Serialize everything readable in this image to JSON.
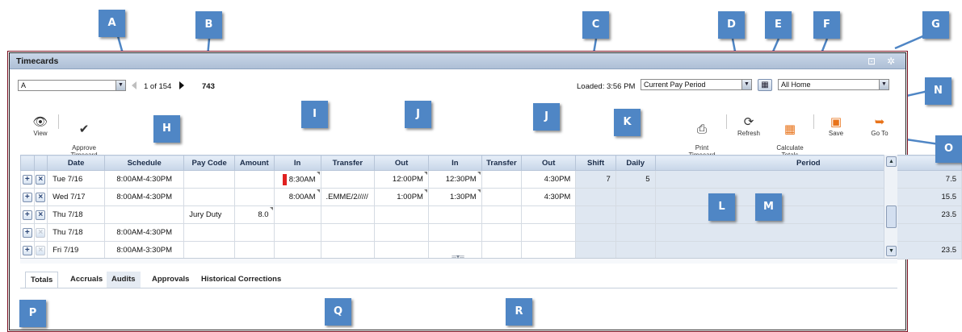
{
  "window": {
    "title": "Timecards"
  },
  "header": {
    "employee_select": "A",
    "pager_text": "1 of 154",
    "employee_id": "743",
    "loaded_text": "Loaded: 3:56 PM",
    "period_select": "Current Pay Period",
    "location_select": "All Home"
  },
  "toolbar": {
    "view": "View",
    "approve": "Approve\nTimecard",
    "print": "Print\nTimecard",
    "refresh": "Refresh",
    "calc": "Calculate\nTotals",
    "save": "Save",
    "goto": "Go To"
  },
  "grid": {
    "columns": [
      "Date",
      "Schedule",
      "Pay Code",
      "Amount",
      "In",
      "Transfer",
      "Out",
      "In",
      "Transfer",
      "Out",
      "Shift",
      "Daily",
      "Period"
    ],
    "rows": [
      {
        "date": "Tue 7/16",
        "schedule": "8:00AM-4:30PM",
        "paycode": "",
        "amount": "",
        "in1": "8:30AM",
        "transfer1": "",
        "out1": "12:00PM",
        "in2": "12:30PM",
        "transfer2": "",
        "out2": "4:30PM",
        "shift": "7",
        "daily": "5",
        "period": "7.5"
      },
      {
        "date": "Wed 7/17",
        "schedule": "8:00AM-4:30PM",
        "paycode": "",
        "amount": "",
        "in1": "8:00AM",
        "transfer1": ".EMME/2/////",
        "out1": "1:00PM",
        "in2": "1:30PM",
        "transfer2": "",
        "out2": "4:30PM",
        "shift": "",
        "daily": "",
        "period": "15.5"
      },
      {
        "date": "Thu 7/18",
        "schedule": "",
        "paycode": "Jury Duty",
        "amount": "8.0",
        "in1": "",
        "transfer1": "",
        "out1": "",
        "in2": "",
        "transfer2": "",
        "out2": "",
        "shift": "",
        "daily": "",
        "period": "23.5"
      },
      {
        "date": "Thu 7/18",
        "schedule": "8:00AM-4:30PM",
        "paycode": "",
        "amount": "",
        "in1": "",
        "transfer1": "",
        "out1": "",
        "in2": "",
        "transfer2": "",
        "out2": "",
        "shift": "",
        "daily": "",
        "period": ""
      },
      {
        "date": "Fri 7/19",
        "schedule": "8:00AM-3:30PM",
        "paycode": "",
        "amount": "",
        "in1": "",
        "transfer1": "",
        "out1": "",
        "in2": "",
        "transfer2": "",
        "out2": "",
        "shift": "",
        "daily": "",
        "period": "23.5"
      }
    ]
  },
  "tabs": [
    "Totals",
    "Accruals",
    "Audits",
    "Approvals",
    "Historical Corrections"
  ],
  "callouts": [
    "A",
    "B",
    "C",
    "D",
    "E",
    "F",
    "G",
    "H",
    "I",
    "J",
    "J",
    "K",
    "L",
    "M",
    "N",
    "O",
    "P",
    "Q",
    "R"
  ],
  "colors": {
    "callout": "#4f86c5",
    "accent_orange": "#e8731a",
    "flag_red": "#e02020",
    "header_blue": "#c8d6e8"
  }
}
